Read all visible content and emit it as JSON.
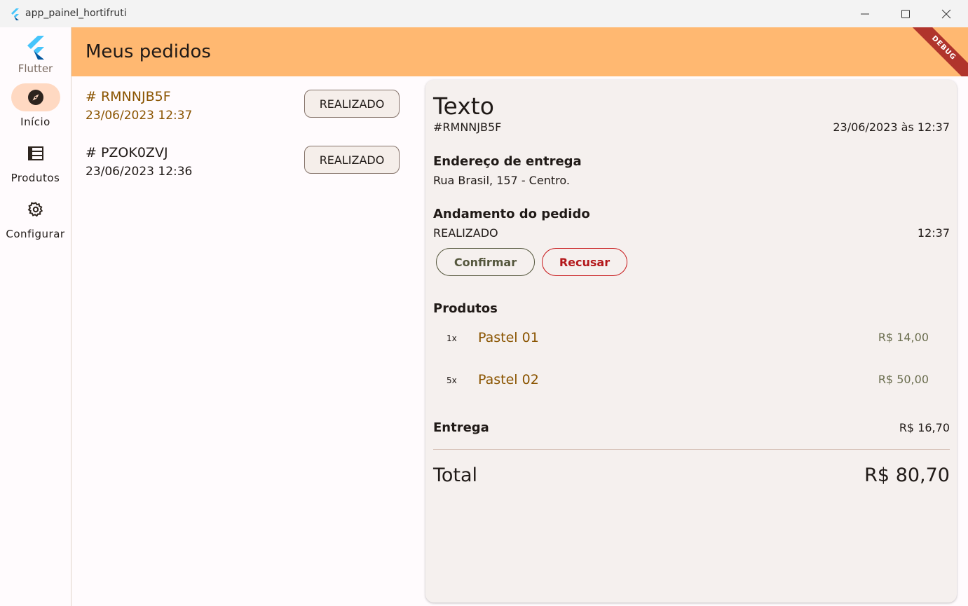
{
  "window": {
    "title": "app_painel_hortifruti"
  },
  "rail": {
    "logo_label": "Flutter",
    "items": [
      {
        "label": "Início",
        "icon": "compass-icon",
        "active": true
      },
      {
        "label": "Produtos",
        "icon": "list-icon",
        "active": false
      },
      {
        "label": "Configurar",
        "icon": "gear-icon",
        "active": false
      }
    ]
  },
  "header": {
    "title": "Meus pedidos",
    "debug_label": "DEBUG"
  },
  "orders": [
    {
      "code": "# RMNNJB5F",
      "date": "23/06/2023 12:37",
      "status": "REALIZADO"
    },
    {
      "code": "# PZOK0ZVJ",
      "date": "23/06/2023 12:36",
      "status": "REALIZADO"
    }
  ],
  "detail": {
    "title": "Texto",
    "code": "#RMNNJB5F",
    "datetime": "23/06/2023 às 12:37",
    "address_heading": "Endereço de entrega",
    "address": "Rua Brasil, 157 - Centro.",
    "progress_heading": "Andamento do pedido",
    "progress_status": "REALIZADO",
    "progress_time": "12:37",
    "confirm_label": "Confirmar",
    "refuse_label": "Recusar",
    "products_heading": "Produtos",
    "products": [
      {
        "qty": "1x",
        "name": "Pastel 01",
        "price": "R$ 14,00"
      },
      {
        "qty": "5x",
        "name": "Pastel 02",
        "price": "R$ 50,00"
      }
    ],
    "delivery_label": "Entrega",
    "delivery_value": "R$ 16,70",
    "total_label": "Total",
    "total_value": "R$ 80,70"
  },
  "colors": {
    "header_bg": "#ffb871",
    "accent_text": "#8a5400",
    "refuse": "#c8191b",
    "confirm": "#55573d",
    "active_pill": "#ffd9c2"
  }
}
